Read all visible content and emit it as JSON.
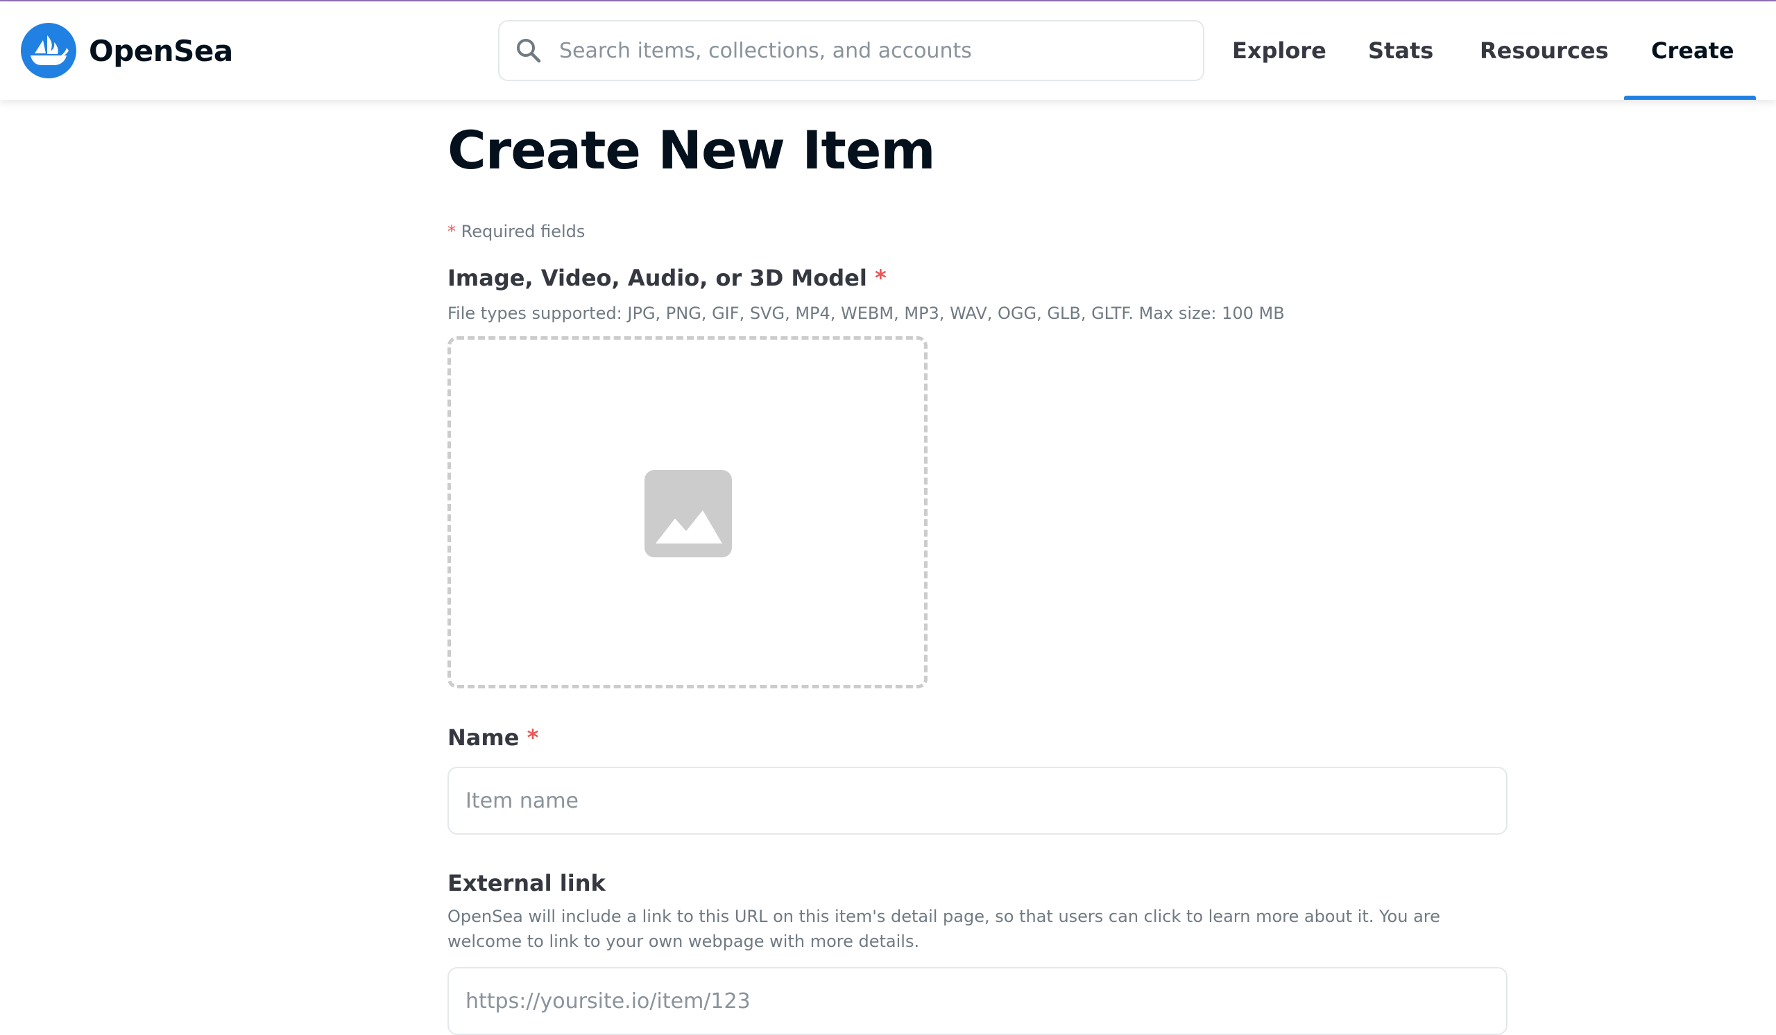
{
  "header": {
    "brand_name": "OpenSea",
    "search": {
      "placeholder": "Search items, collections, and accounts",
      "value": ""
    },
    "nav": {
      "explore": "Explore",
      "stats": "Stats",
      "resources": "Resources",
      "create": "Create"
    },
    "active_nav": "Create"
  },
  "page": {
    "title": "Create New Item",
    "required_note": "Required fields",
    "required_marker": "*"
  },
  "media_field": {
    "label": "Image, Video, Audio, or 3D Model",
    "description": "File types supported: JPG, PNG, GIF, SVG, MP4, WEBM, MP3, WAV, OGG, GLB, GLTF. Max size: 100 MB"
  },
  "name_field": {
    "label": "Name",
    "placeholder": "Item name",
    "value": ""
  },
  "external_link_field": {
    "label": "External link",
    "description": "OpenSea will include a link to this URL on this item's detail page, so that users can click to learn more about it. You are welcome to link to your own webpage with more details.",
    "placeholder": "https://yoursite.io/item/123",
    "value": ""
  },
  "colors": {
    "brand_blue": "#2081e2",
    "required_red": "#eb5757",
    "text_primary": "#04111d",
    "text_secondary": "#707a83",
    "border": "#e5e8eb"
  },
  "icons": {
    "logo": "opensea-boat-icon",
    "search": "search-icon",
    "media_placeholder": "image-icon"
  }
}
